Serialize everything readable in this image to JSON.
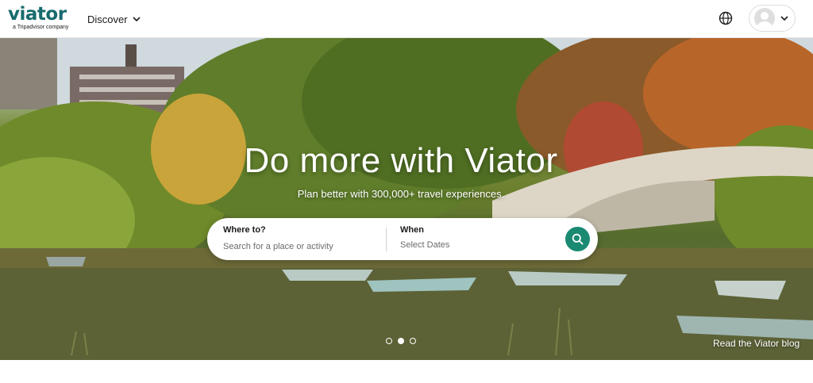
{
  "header": {
    "logo_text": "viator",
    "logo_tagline": "a Tripadvisor company",
    "nav_discover": "Discover",
    "icons": [
      "globe-icon",
      "user-avatar-icon",
      "chevron-down-icon"
    ]
  },
  "hero": {
    "title": "Do more with Viator",
    "subtitle": "Plan better with 300,000+ travel experiences.",
    "carousel": {
      "slide_count": 3,
      "active_slide": 2
    },
    "blog_link": "Read the Viator blog"
  },
  "search": {
    "where_label": "Where to?",
    "where_placeholder": "Search for a place or activity",
    "when_label": "When",
    "when_placeholder": "Select Dates",
    "button_icon": "search-icon"
  },
  "colors": {
    "brand": "#186b6d",
    "search_button": "#1a8a73"
  }
}
